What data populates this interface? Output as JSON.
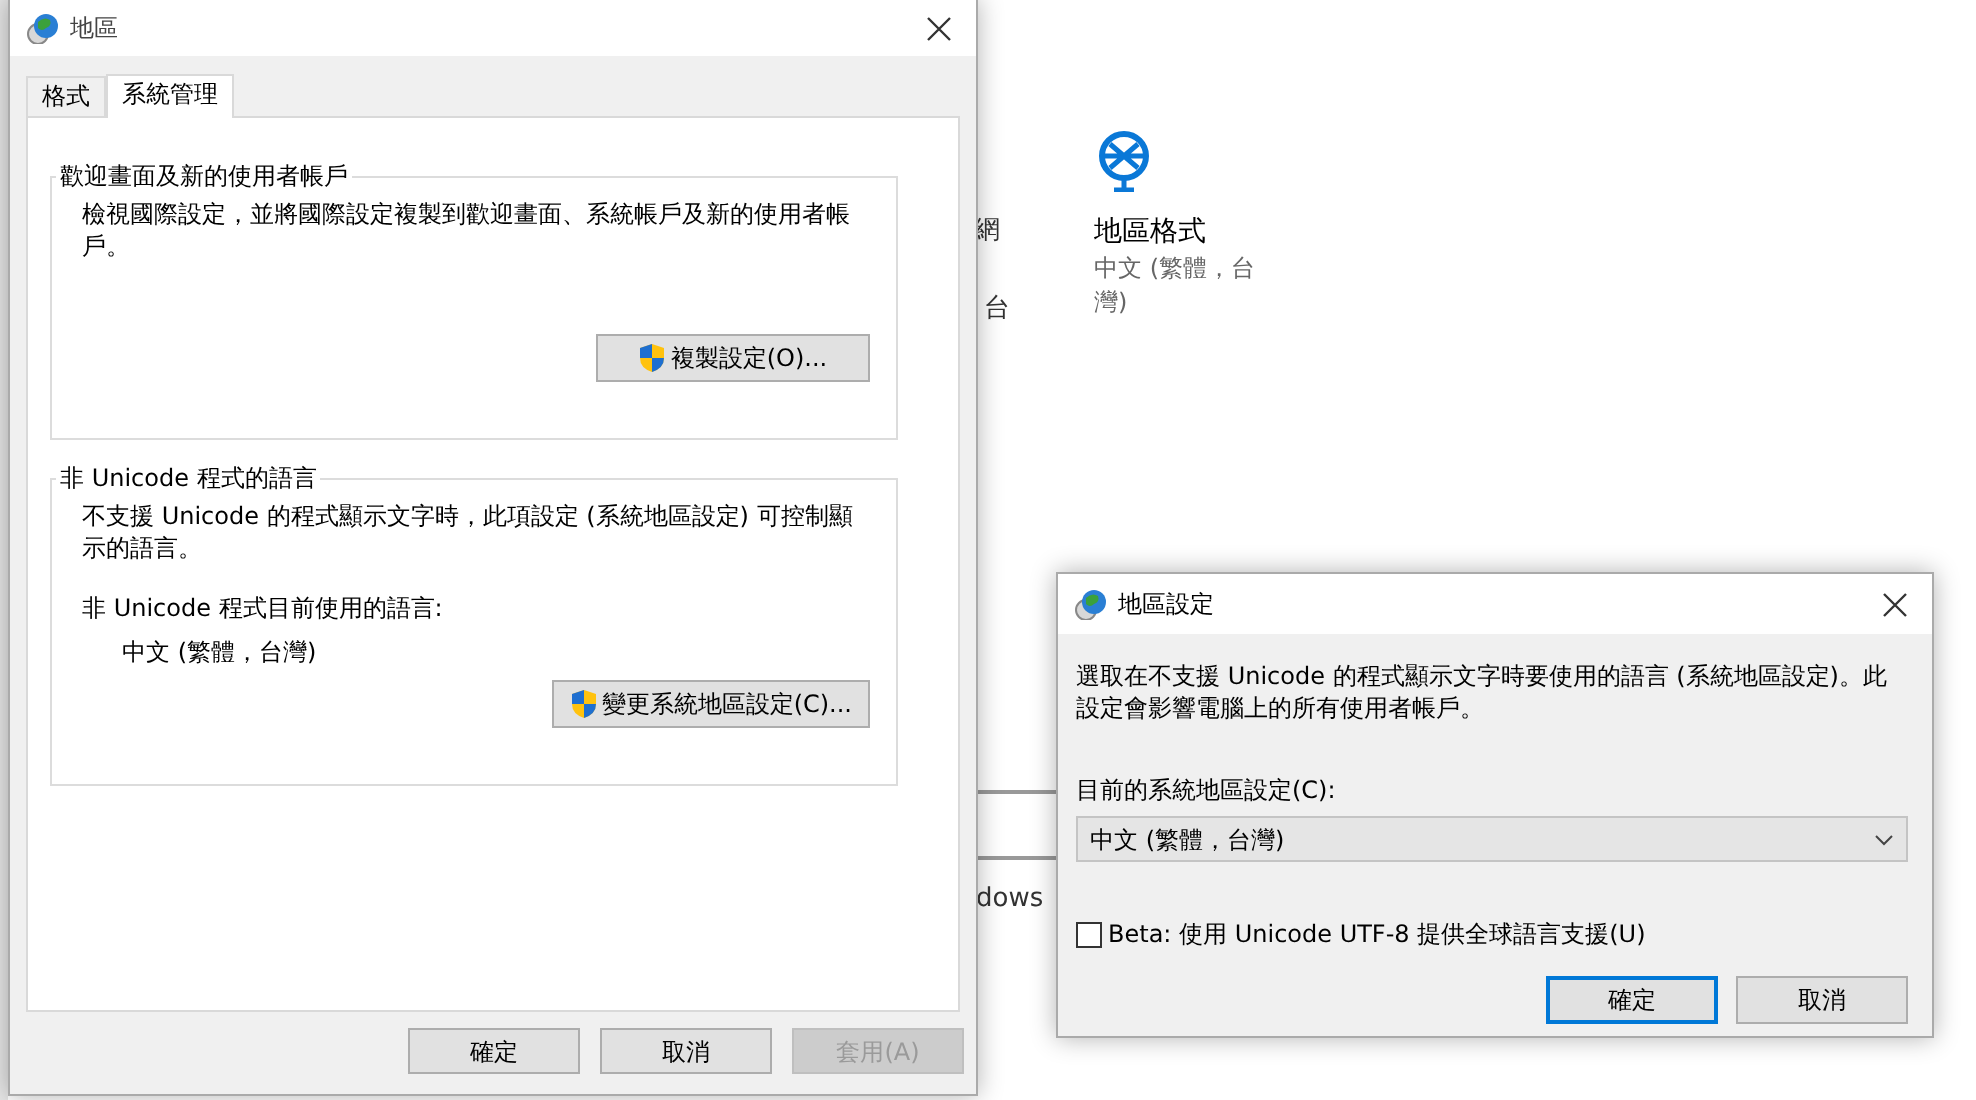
{
  "background": {
    "regional_format": {
      "title": "地區格式",
      "value": "中文 (繁體，台灣)"
    },
    "fragments": [
      "網",
      "台",
      "dows"
    ]
  },
  "region_window": {
    "title": "地區",
    "tabs": [
      {
        "label": "格式",
        "selected": false
      },
      {
        "label": "系統管理",
        "selected": true
      }
    ],
    "groups": [
      {
        "title": "歡迎畫面及新的使用者帳戶",
        "description": "檢視國際設定，並將國際設定複製到歡迎畫面、系統帳戶及新的使用者帳戶。",
        "button": "複製設定(O)..."
      },
      {
        "title": "非 Unicode 程式的語言",
        "description": "不支援 Unicode 的程式顯示文字時，此項設定 (系統地區設定) 可控制顯示的語言。",
        "current_label": "非 Unicode 程式目前使用的語言:",
        "current_value": "中文 (繁體，台灣)",
        "button": "變更系統地區設定(C)..."
      }
    ],
    "buttons": [
      {
        "label": "確定",
        "disabled": false
      },
      {
        "label": "取消",
        "disabled": false
      },
      {
        "label": "套用(A)",
        "disabled": true
      }
    ]
  },
  "locale_dialog": {
    "title": "地區設定",
    "description": "選取在不支援 Unicode 的程式顯示文字時要使用的語言 (系統地區設定)。此設定會影響電腦上的所有使用者帳戶。",
    "field_label": "目前的系統地區設定(C):",
    "dropdown": {
      "value": "中文 (繁體，台灣)"
    },
    "checkbox": {
      "label": "Beta: 使用 Unicode UTF-8 提供全球語言支援(U)",
      "checked": false
    },
    "buttons": [
      {
        "label": "確定",
        "default": true
      },
      {
        "label": "取消",
        "default": false
      }
    ]
  }
}
